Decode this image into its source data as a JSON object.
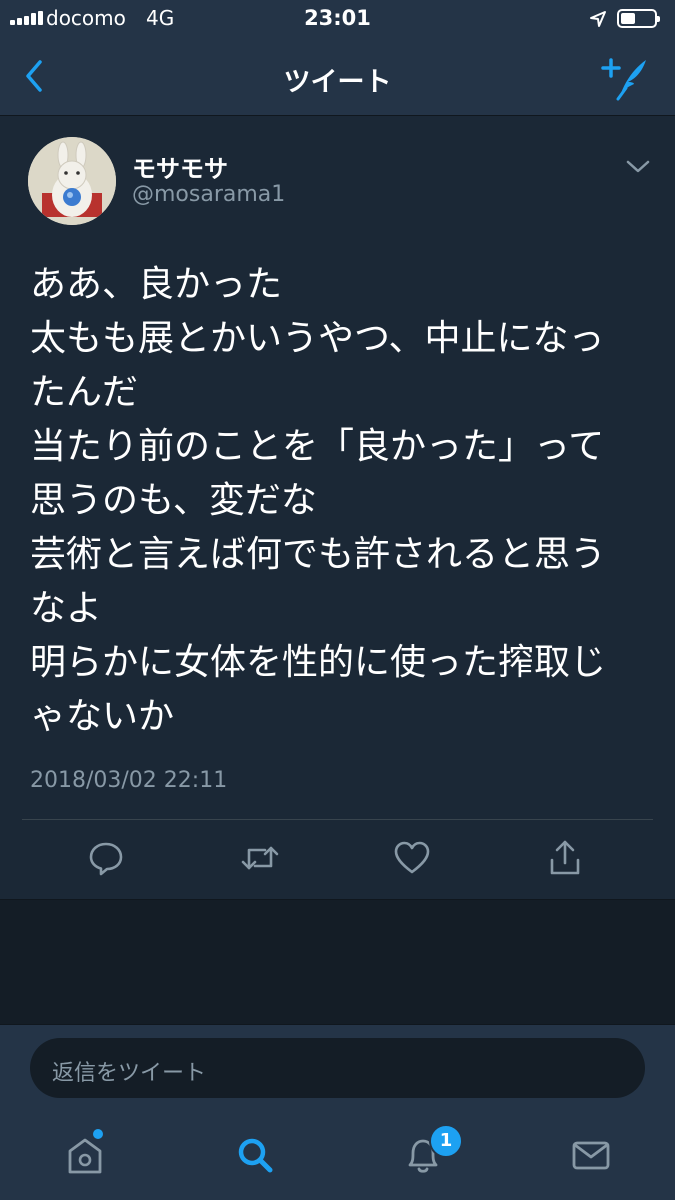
{
  "status_bar": {
    "carrier": "docomo",
    "network": "4G",
    "time": "23:01"
  },
  "nav": {
    "title": "ツイート",
    "back_icon": "chevron-left-icon",
    "compose_icon": "compose-tweet-icon"
  },
  "tweet": {
    "display_name": "モサモサ",
    "handle": "@mosarama1",
    "text_lines": [
      "ああ、良かった",
      "太もも展とかいうやつ、中止になっ",
      "たんだ",
      "当たり前のことを「良かった」って",
      "思うのも、変だな",
      "芸術と言えば何でも許されると思う",
      "なよ",
      "明らかに女体を性的に使った搾取じ",
      "ゃないか"
    ],
    "timestamp": "2018/03/02 22:11",
    "actions": [
      "reply-icon",
      "retweet-icon",
      "like-icon",
      "share-icon"
    ]
  },
  "reply": {
    "placeholder": "返信をツイート"
  },
  "tab_bar": {
    "items": [
      "home-icon",
      "search-icon",
      "notifications-icon",
      "messages-icon"
    ],
    "notification_count": "1"
  },
  "colors": {
    "background": "#141d26",
    "card": "#1b2836",
    "bar": "#243447",
    "accent": "#1da1f2",
    "muted": "#8899a6"
  }
}
